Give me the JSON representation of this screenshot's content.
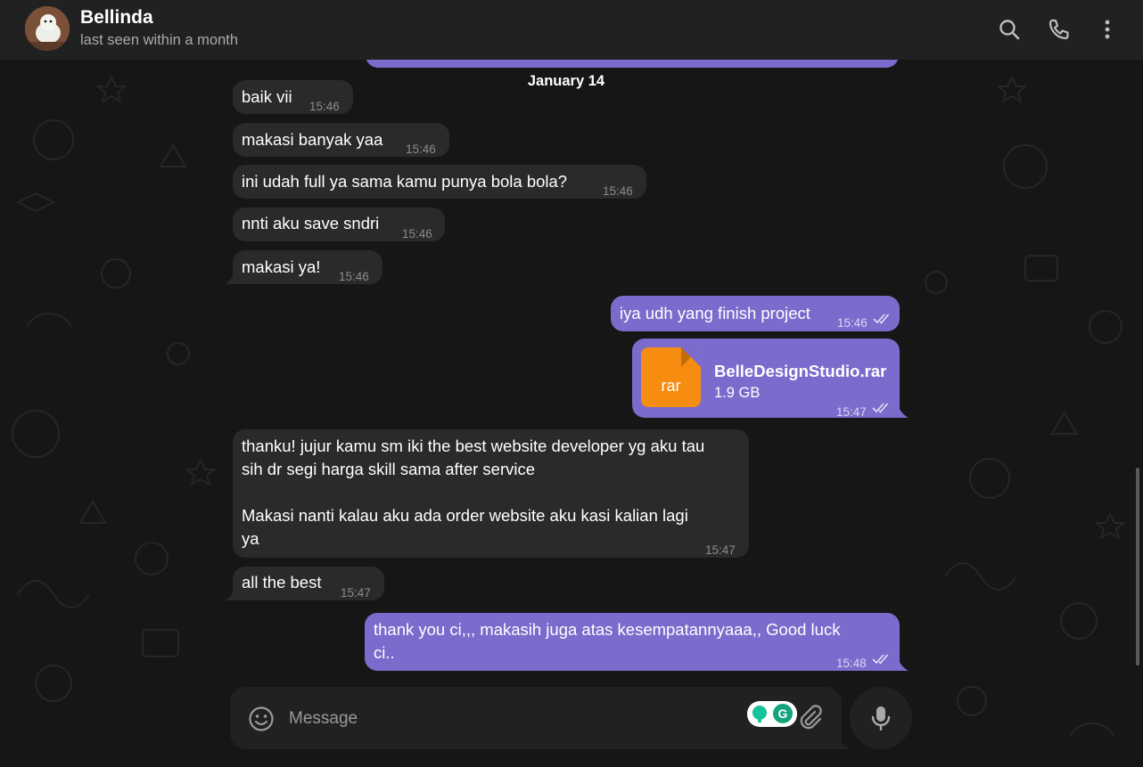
{
  "header": {
    "name": "Bellinda",
    "status": "last seen within a month"
  },
  "date_separator": "January 14",
  "messages": [
    {
      "dir": "in",
      "text": "baik vii",
      "time": "15:46"
    },
    {
      "dir": "in",
      "text": "makasi banyak yaa",
      "time": "15:46"
    },
    {
      "dir": "in",
      "text": "ini udah full ya sama kamu punya bola bola?",
      "time": "15:46"
    },
    {
      "dir": "in",
      "text": "nnti aku save sndri",
      "time": "15:46"
    },
    {
      "dir": "in",
      "text": "makasi ya!",
      "time": "15:46"
    },
    {
      "dir": "out",
      "text": "iya udh yang finish project",
      "time": "15:46"
    },
    {
      "dir": "out",
      "type": "file",
      "file_ext": "rar",
      "file_name": "BelleDesignStudio.rar",
      "file_size": "1.9 GB",
      "time": "15:47"
    },
    {
      "dir": "in",
      "lines": [
        "thanku! jujur kamu sm iki the best website developer yg aku tau",
        "sih dr segi harga skill sama after service",
        "",
        "Makasi nanti kalau aku ada order website aku kasi kalian lagi",
        "ya"
      ],
      "time": "15:47"
    },
    {
      "dir": "in",
      "text": "all the best",
      "time": "15:47"
    },
    {
      "dir": "out",
      "lines": [
        "thank you ci,,, makasih juga atas kesempatannyaaa,, Good luck",
        "ci.."
      ],
      "time": "15:48"
    }
  ],
  "composer": {
    "placeholder": "Message"
  },
  "colors": {
    "outgoing": "#7a6bcc",
    "incoming": "#2a2a2a",
    "header": "#212121",
    "file_icon": "#f68d11"
  },
  "icons": [
    "search-icon",
    "phone-icon",
    "more-vertical-icon",
    "emoji-icon",
    "grammarly-icon",
    "attach-icon",
    "mic-icon",
    "double-check-icon"
  ]
}
